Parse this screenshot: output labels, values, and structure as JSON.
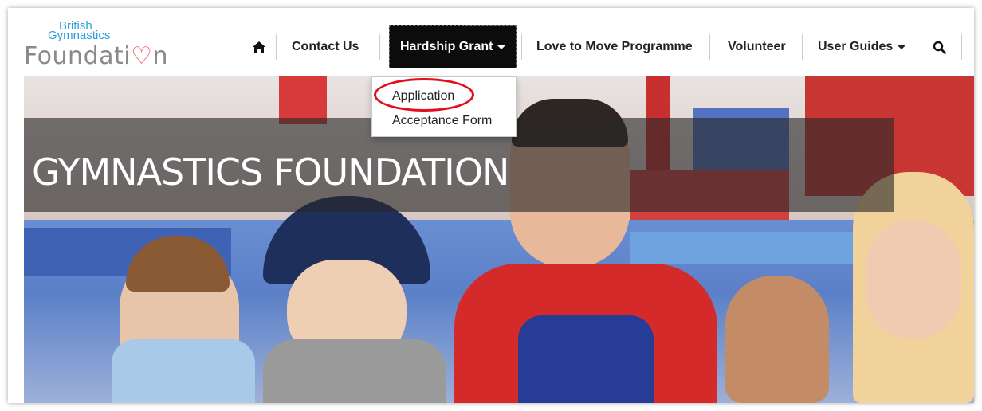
{
  "logo": {
    "line1": "British",
    "line2": "Gymnastics",
    "line3a": "Foundati",
    "line3b": "n"
  },
  "nav": {
    "home_icon": "home-icon",
    "contact": "Contact Us",
    "hardship": "Hardship Grant",
    "love_to_move": "Love to Move Programme",
    "volunteer": "Volunteer",
    "user_guides": "User Guides",
    "search_icon": "search-icon"
  },
  "dropdown": {
    "items": [
      "Application",
      "Acceptance Form"
    ]
  },
  "hero": {
    "title": "GYMNASTICS FOUNDATION"
  },
  "colors": {
    "nav_active_bg": "#0c0c0c",
    "highlight_circle": "#e01020",
    "brand_blue": "#2e9fd8"
  }
}
